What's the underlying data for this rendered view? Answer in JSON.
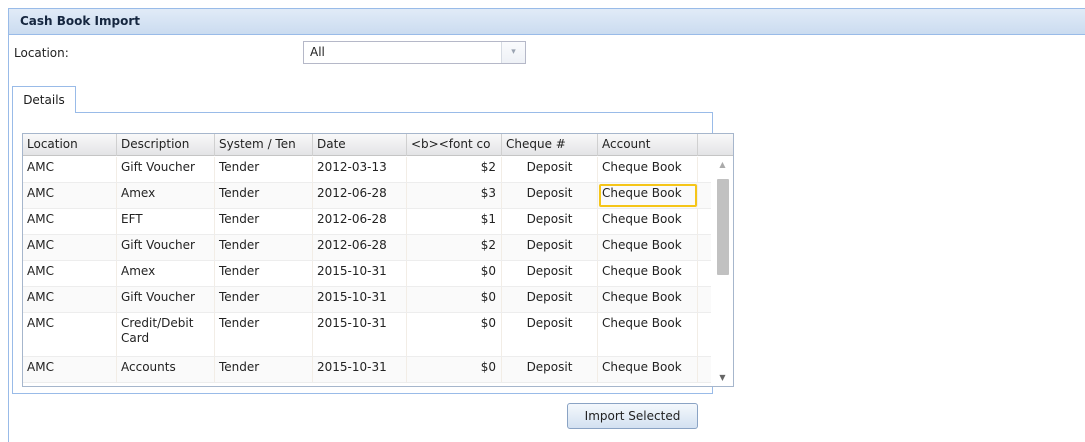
{
  "window": {
    "title": "Cash Book Import"
  },
  "location": {
    "label": "Location:",
    "selected": "All",
    "trigger_glyph": "▾"
  },
  "tabs": [
    {
      "label": "Details"
    }
  ],
  "grid": {
    "columns": [
      "Location",
      "Description",
      "System / Ten",
      "Date",
      "<b><font co",
      "Cheque #",
      "Account"
    ],
    "rows": [
      [
        "AMC",
        "Gift Voucher",
        "Tender",
        "2012-03-13",
        "$2",
        "Deposit",
        "Cheque Book"
      ],
      [
        "AMC",
        "Amex",
        "Tender",
        "2012-06-28",
        "$3",
        "Deposit",
        "Cheque Book"
      ],
      [
        "AMC",
        "EFT",
        "Tender",
        "2012-06-28",
        "$1",
        "Deposit",
        "Cheque Book"
      ],
      [
        "AMC",
        "Gift Voucher",
        "Tender",
        "2012-06-28",
        "$2",
        "Deposit",
        "Cheque Book"
      ],
      [
        "AMC",
        "Amex",
        "Tender",
        "2015-10-31",
        "$0",
        "Deposit",
        "Cheque Book"
      ],
      [
        "AMC",
        "Gift Voucher",
        "Tender",
        "2015-10-31",
        "$0",
        "Deposit",
        "Cheque Book"
      ],
      [
        "AMC",
        "Credit/Debit Card",
        "Tender",
        "2015-10-31",
        "$0",
        "Deposit",
        "Cheque Book"
      ],
      [
        "AMC",
        "Accounts",
        "Tender",
        "2015-10-31",
        "$0",
        "Deposit",
        "Cheque Book"
      ]
    ],
    "highlighted_cell": {
      "row": 1,
      "column": "Account"
    },
    "scroll_up_glyph": "▲",
    "scroll_down_glyph": "▼"
  },
  "actions": {
    "import_label": "Import Selected"
  },
  "colors": {
    "highlight": "#f5c518",
    "title_bar": "#cbdcf0",
    "border": "#99bbe8"
  }
}
